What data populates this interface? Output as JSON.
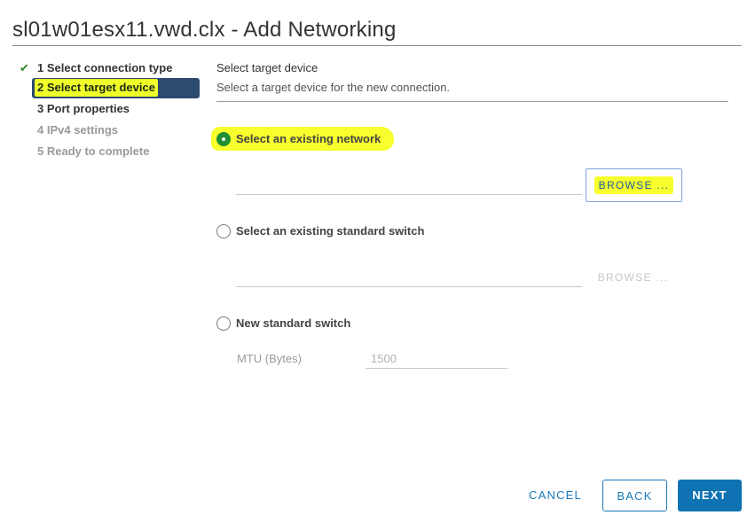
{
  "window": {
    "title": "sl01w01esx11.vwd.clx - Add Networking"
  },
  "steps": [
    {
      "label": "1 Select connection type",
      "state": "done",
      "icon": "check-icon"
    },
    {
      "label": "2 Select target device",
      "state": "active"
    },
    {
      "label": "3 Port properties",
      "state": "pending"
    },
    {
      "label": "4 IPv4 settings",
      "state": "disabled"
    },
    {
      "label": "5 Ready to complete",
      "state": "disabled"
    }
  ],
  "section": {
    "title": "Select target device",
    "subtitle": "Select a target device for the new connection."
  },
  "options": {
    "existing_network": {
      "label": "Select an existing network",
      "checked": true
    },
    "existing_switch": {
      "label": "Select an existing standard switch",
      "checked": false
    },
    "new_switch": {
      "label": "New standard switch",
      "checked": false
    }
  },
  "browse": {
    "network_label": "BROWSE ...",
    "switch_label": "BROWSE ..."
  },
  "mtu": {
    "label": "MTU (Bytes)",
    "value": "1500"
  },
  "footer": {
    "cancel_label": "CANCEL",
    "back_label": "BACK",
    "next_label": "NEXT"
  },
  "colors": {
    "accent": "#0f72b2",
    "active_step_bg": "#2d4a6f",
    "highlight": "#f7ff2c",
    "radio_checked": "#1f8f32"
  }
}
